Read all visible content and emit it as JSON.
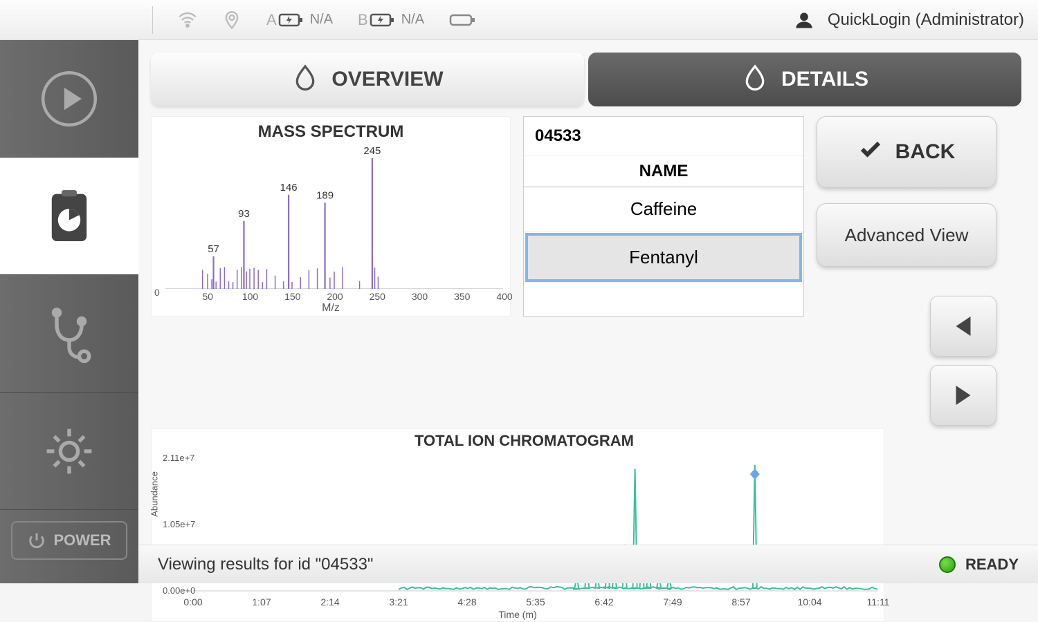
{
  "topbar": {
    "battA_prefix": "A",
    "battA_value": "N/A",
    "battB_prefix": "B",
    "battB_value": "N/A",
    "user": "QuickLogin (Administrator)"
  },
  "sidebar": {
    "power_label": "POWER"
  },
  "tabs": {
    "overview": "OVERVIEW",
    "details": "DETAILS"
  },
  "results": {
    "id": "04533",
    "name_header": "NAME",
    "rows": [
      "Caffeine",
      "Fentanyl"
    ],
    "selected_index": 1
  },
  "buttons": {
    "back": "BACK",
    "advanced": "Advanced View"
  },
  "bottombar": {
    "message": "Viewing results for id \"04533\"",
    "status": "READY"
  },
  "chart_data": [
    {
      "type": "bar",
      "title": "MASS SPECTRUM",
      "xlabel": "M/z",
      "ylabel": "",
      "xticks": [
        50,
        100,
        150,
        200,
        250,
        300,
        350,
        400
      ],
      "xlim": [
        0,
        400
      ],
      "labeled_peaks": [
        {
          "mz": 57,
          "label": "57",
          "rel_intensity": 0.25
        },
        {
          "mz": 93,
          "label": "93",
          "rel_intensity": 0.52
        },
        {
          "mz": 146,
          "label": "146",
          "rel_intensity": 0.72
        },
        {
          "mz": 189,
          "label": "189",
          "rel_intensity": 0.66
        },
        {
          "mz": 245,
          "label": "245",
          "rel_intensity": 1.0
        }
      ],
      "minor_peaks_mz": [
        44,
        50,
        55,
        60,
        65,
        70,
        75,
        80,
        85,
        90,
        96,
        100,
        105,
        110,
        115,
        120,
        130,
        140,
        150,
        160,
        170,
        180,
        195,
        200,
        210,
        230,
        248,
        252
      ],
      "color": "#8a6cc7"
    },
    {
      "type": "line",
      "title": "TOTAL ION CHROMATOGRAM",
      "xlabel": "Time (m)",
      "ylabel": "Abundance",
      "ylim": [
        0,
        21100000.0
      ],
      "y_ticks": [
        "0.00e+0",
        "1.05e+7",
        "2.11e+7"
      ],
      "x_ticks": [
        "0:00",
        "1:07",
        "2:14",
        "3:21",
        "4:28",
        "5:35",
        "6:42",
        "7:49",
        "8:57",
        "10:04",
        "11:11"
      ],
      "data_start_x_frac": 0.3,
      "peaks": [
        {
          "x_frac": 0.56,
          "rel_h": 0.1
        },
        {
          "x_frac": 0.575,
          "rel_h": 0.22
        },
        {
          "x_frac": 0.59,
          "rel_h": 0.12
        },
        {
          "x_frac": 0.605,
          "rel_h": 0.28
        },
        {
          "x_frac": 0.615,
          "rel_h": 0.2
        },
        {
          "x_frac": 0.63,
          "rel_h": 0.35
        },
        {
          "x_frac": 0.645,
          "rel_h": 0.92
        },
        {
          "x_frac": 0.655,
          "rel_h": 0.3
        },
        {
          "x_frac": 0.665,
          "rel_h": 0.25
        },
        {
          "x_frac": 0.68,
          "rel_h": 0.12
        },
        {
          "x_frac": 0.695,
          "rel_h": 0.1
        },
        {
          "x_frac": 0.82,
          "rel_h": 0.95
        }
      ],
      "marker_x_frac": 0.82,
      "color": "#3bbf9a"
    }
  ]
}
